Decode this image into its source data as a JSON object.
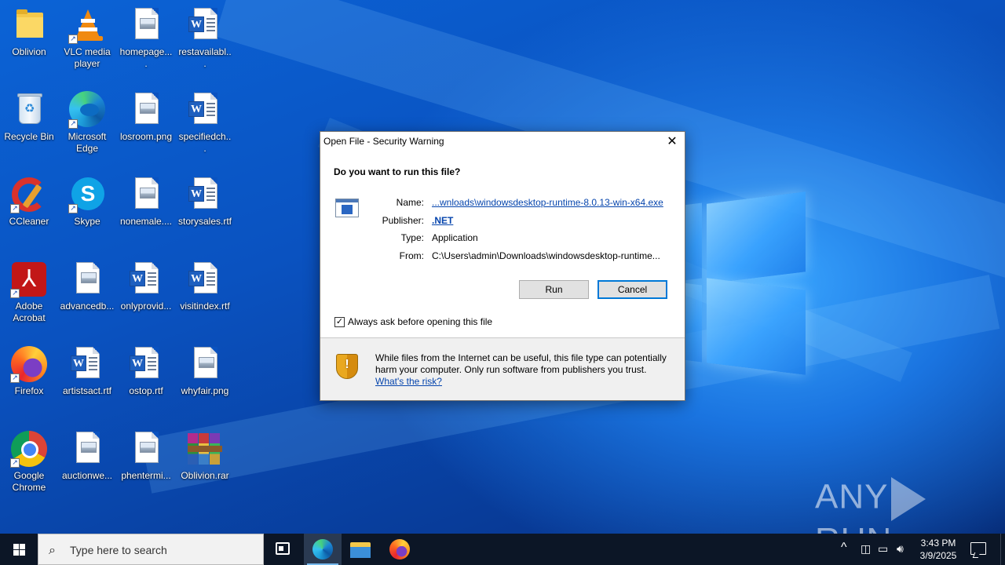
{
  "desktop": {
    "icons": [
      {
        "label": "Oblivion",
        "icon": "folder-icon"
      },
      {
        "label": "VLC media player",
        "icon": "vlc-icon"
      },
      {
        "label": "homepage....",
        "icon": "image-file-icon"
      },
      {
        "label": "restavailabl...",
        "icon": "word-doc-icon"
      },
      {
        "label": "Recycle Bin",
        "icon": "recycle-bin-icon"
      },
      {
        "label": "Microsoft Edge",
        "icon": "edge-icon"
      },
      {
        "label": "losroom.png",
        "icon": "image-file-icon"
      },
      {
        "label": "specifiedch...",
        "icon": "word-doc-icon"
      },
      {
        "label": "CCleaner",
        "icon": "ccleaner-icon"
      },
      {
        "label": "Skype",
        "icon": "skype-icon"
      },
      {
        "label": "nonemale....",
        "icon": "image-file-icon"
      },
      {
        "label": "storysales.rtf",
        "icon": "word-doc-icon"
      },
      {
        "label": "Adobe Acrobat",
        "icon": "acrobat-icon"
      },
      {
        "label": "advancedb...",
        "icon": "image-file-icon"
      },
      {
        "label": "onlyprovid...",
        "icon": "word-doc-icon"
      },
      {
        "label": "visitindex.rtf",
        "icon": "word-doc-icon"
      },
      {
        "label": "Firefox",
        "icon": "firefox-icon"
      },
      {
        "label": "artistsact.rtf",
        "icon": "word-doc-icon"
      },
      {
        "label": "ostop.rtf",
        "icon": "word-doc-icon"
      },
      {
        "label": "whyfair.png",
        "icon": "image-file-icon"
      },
      {
        "label": "Google Chrome",
        "icon": "chrome-icon"
      },
      {
        "label": "auctionwe...",
        "icon": "image-file-icon"
      },
      {
        "label": "phentermi...",
        "icon": "image-file-icon"
      },
      {
        "label": "Oblivion.rar",
        "icon": "winrar-icon"
      }
    ]
  },
  "dialog": {
    "title": "Open File - Security Warning",
    "close_glyph": "✕",
    "question": "Do you want to run this file?",
    "name_label": "Name:",
    "name_value": "...wnloads\\windowsdesktop-runtime-8.0.13-win-x64.exe",
    "publisher_label": "Publisher:",
    "publisher_value": ".NET",
    "type_label": "Type:",
    "type_value": "Application",
    "from_label": "From:",
    "from_value": "C:\\Users\\admin\\Downloads\\windowsdesktop-runtime...",
    "run_label": "Run",
    "cancel_label": "Cancel",
    "checkbox_label": "Always ask before opening this file",
    "checkbox_checked": true,
    "warning_text": "While files from the Internet can be useful, this file type can potentially harm your computer. Only run software from publishers you trust.",
    "risk_link": "What's the risk?"
  },
  "watermark": {
    "left": "ANY",
    "right": "RUN"
  },
  "taskbar": {
    "search_placeholder": "Type here to search",
    "time": "3:43 PM",
    "date": "3/9/2025",
    "chevron": "^"
  }
}
